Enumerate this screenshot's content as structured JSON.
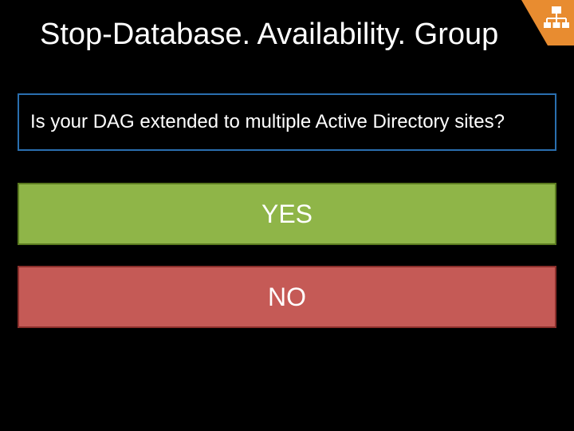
{
  "title": "Stop-Database. Availability. Group",
  "question": "Is your DAG extended to multiple Active Directory sites?",
  "options": {
    "yes": "YES",
    "no": "NO"
  },
  "colors": {
    "question_border": "#2a6fb0",
    "yes_bg": "#8fb548",
    "no_bg": "#c55a56",
    "icon_bg": "#e88c30"
  }
}
